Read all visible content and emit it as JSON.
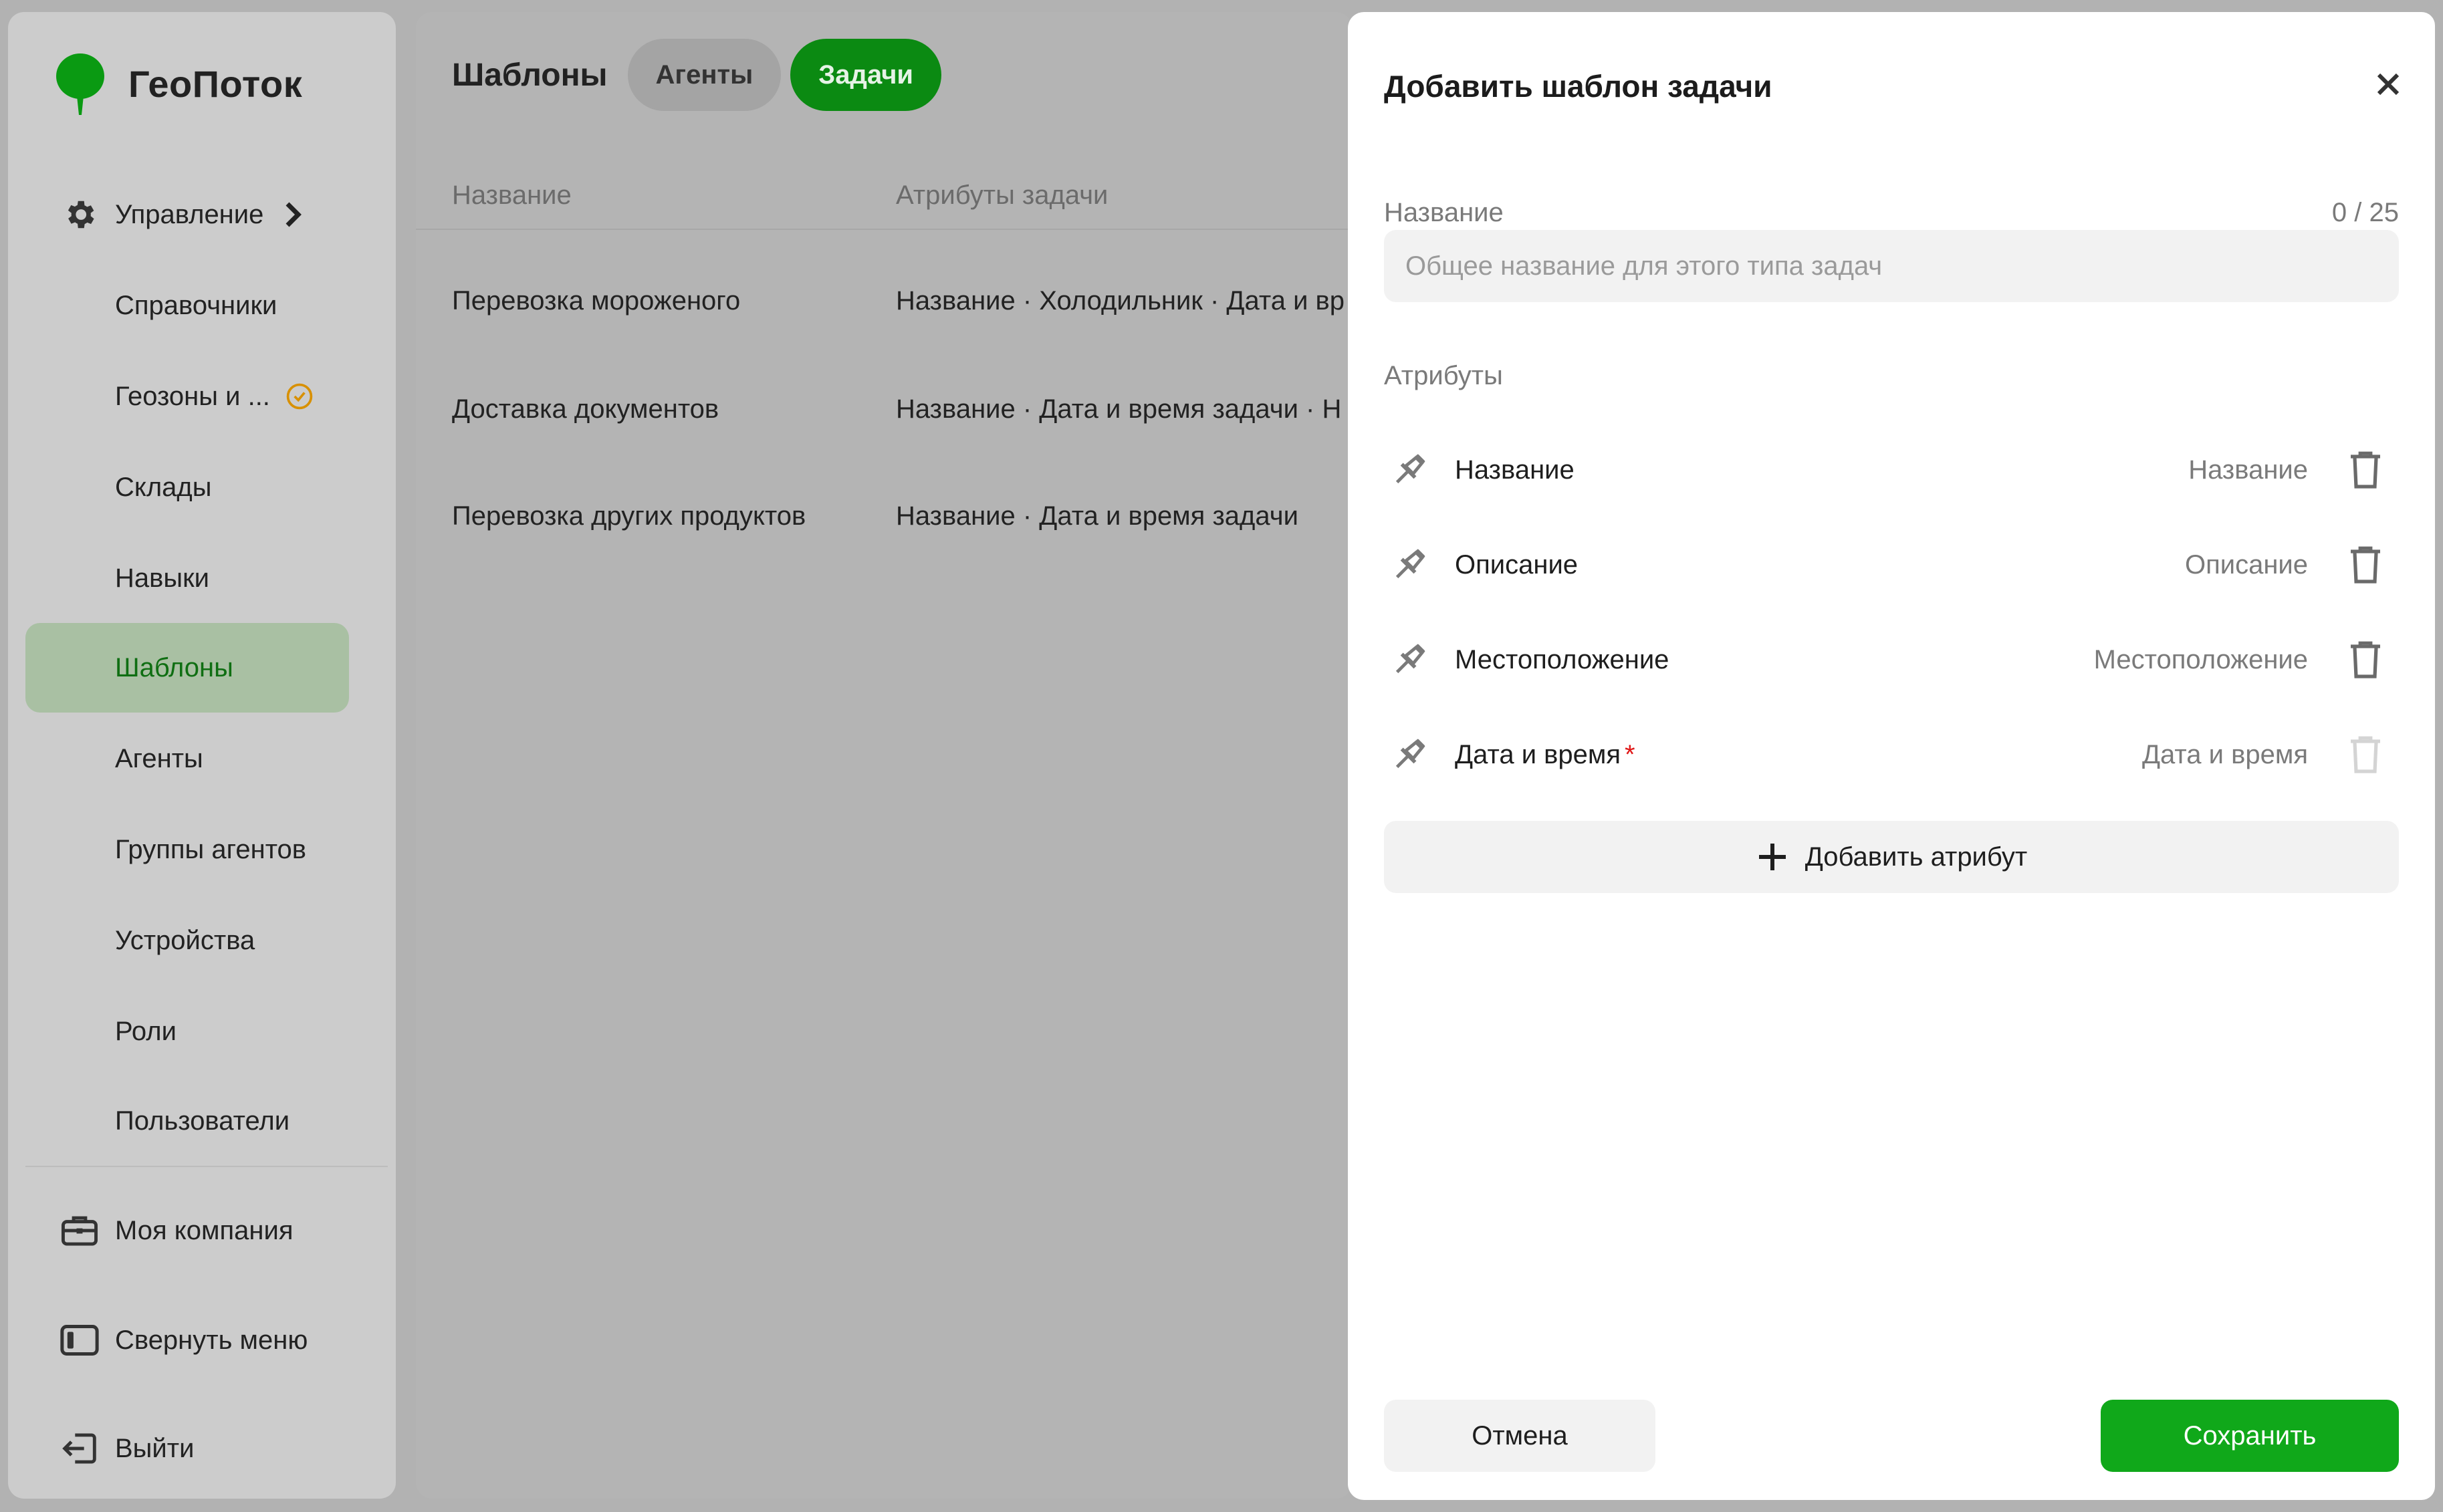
{
  "brand": {
    "name": "ГеоПоток",
    "logo_icon": "tree-pin-icon",
    "color": "#0a9a12"
  },
  "sidebar": {
    "management": {
      "label": "Управление",
      "icon": "gear-icon"
    },
    "items": [
      {
        "label": "Справочники"
      },
      {
        "label": "Геозоны и ...",
        "badge_icon": "clock-icon"
      },
      {
        "label": "Склады"
      },
      {
        "label": "Навыки"
      },
      {
        "label": "Шаблоны",
        "active": true
      },
      {
        "label": "Агенты"
      },
      {
        "label": "Группы агентов"
      },
      {
        "label": "Устройства"
      },
      {
        "label": "Роли"
      },
      {
        "label": "Пользователи"
      }
    ],
    "company": {
      "label": "Моя компания",
      "icon": "briefcase-icon"
    },
    "collapse": {
      "label": "Свернуть меню",
      "icon": "sidebar-collapse-icon"
    },
    "logout": {
      "label": "Выйти",
      "icon": "logout-icon"
    }
  },
  "main": {
    "title": "Шаблоны",
    "tabs": [
      {
        "label": "Агенты",
        "active": false
      },
      {
        "label": "Задачи",
        "active": true
      }
    ],
    "columns": [
      "Название",
      "Атрибуты задачи"
    ],
    "rows": [
      {
        "name": "Перевозка мороженого",
        "attrs": "Название · Холодильник · Дата и вр"
      },
      {
        "name": "Доставка документов",
        "attrs": "Название · Дата и время задачи · Н"
      },
      {
        "name": "Перевозка других продуктов",
        "attrs": "Название · Дата и время задачи"
      }
    ]
  },
  "modal": {
    "title": "Добавить шаблон задачи",
    "name_label": "Название",
    "name_counter": "0 / 25",
    "name_value": "",
    "name_placeholder": "Общее название для этого типа задач",
    "attributes_label": "Атрибуты",
    "attributes": [
      {
        "name": "Название",
        "type": "Название",
        "required": false,
        "deletable": true
      },
      {
        "name": "Описание",
        "type": "Описание",
        "required": false,
        "deletable": true
      },
      {
        "name": "Местоположение",
        "type": "Местоположение",
        "required": false,
        "deletable": true
      },
      {
        "name": "Дата и время",
        "type": "Дата и время",
        "required": true,
        "required_mark": "*",
        "deletable": false
      }
    ],
    "add_attribute_label": "Добавить атрибут",
    "cancel_label": "Отмена",
    "save_label": "Сохранить",
    "save_color": "#10a81a"
  }
}
